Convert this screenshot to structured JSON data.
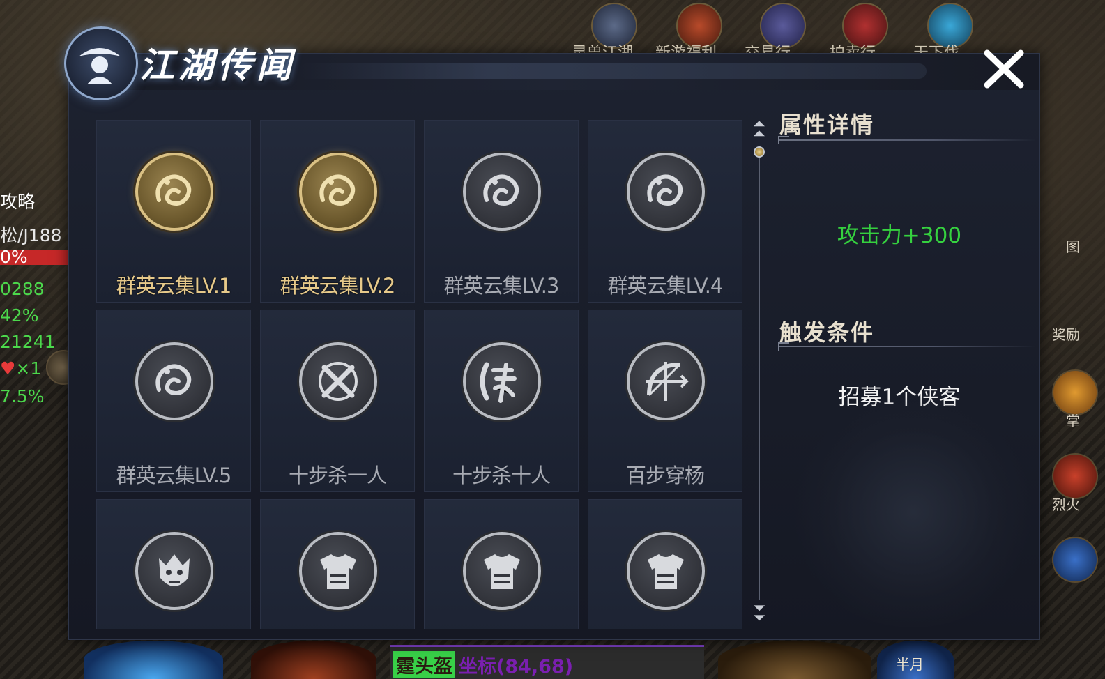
{
  "hud": {
    "strategy_label": "攻略",
    "player_name": "松/J188",
    "hp_percent": "0%",
    "stat_1": "0288",
    "stat_2": "42%",
    "stat_3": "21241",
    "stat_4": "×1",
    "stat_5": "7.5%"
  },
  "top_menu": [
    {
      "label": "灵兽江湖",
      "icon": "meditating-figure-icon"
    },
    {
      "label": "新游福利",
      "icon": "treasure-chest-icon"
    },
    {
      "label": "交易行",
      "icon": "trade-cart-icon"
    },
    {
      "label": "拍卖行",
      "icon": "auction-scroll-icon"
    },
    {
      "label": "天下伐",
      "icon": "swirl-orb-icon"
    }
  ],
  "right_hud": {
    "map_label": "图",
    "reward_label": "奖励",
    "palm_label": "掌",
    "fire_label": "烈火"
  },
  "bottom_bar": {
    "map_name": "霆头盔",
    "coordinates": "坐标(84,68)",
    "half_moon_label": "半月"
  },
  "panel": {
    "title": "江湖传闻",
    "close_icon": "close-x-icon",
    "logo_icon": "swordsman-hat-icon"
  },
  "achievements": [
    {
      "label": "群英云集LV.1",
      "state": "gold",
      "icon": "dragon-icon"
    },
    {
      "label": "群英云集LV.2",
      "state": "gold",
      "icon": "dragon-icon"
    },
    {
      "label": "群英云集LV.3",
      "state": "grey",
      "icon": "dragon-icon"
    },
    {
      "label": "群英云集LV.4",
      "state": "grey",
      "icon": "dragon-icon"
    },
    {
      "label": "群英云集LV.5",
      "state": "grey",
      "icon": "dragon-icon"
    },
    {
      "label": "十步杀一人",
      "state": "grey",
      "icon": "crossed-swords-icon"
    },
    {
      "label": "十步杀十人",
      "state": "grey",
      "icon": "slash-character-icon"
    },
    {
      "label": "百步穿杨",
      "state": "grey",
      "icon": "bow-arrow-icon"
    },
    {
      "label": "",
      "state": "grey",
      "icon": "demon-mask-icon"
    },
    {
      "label": "",
      "state": "grey",
      "icon": "armor-icon"
    },
    {
      "label": "",
      "state": "grey",
      "icon": "armor-icon"
    },
    {
      "label": "",
      "state": "grey",
      "icon": "armor-icon"
    }
  ],
  "detail": {
    "attribute_heading": "属性详情",
    "attribute_value": "攻击力+300",
    "condition_heading": "触发条件",
    "condition_value": "招募1个侠客"
  },
  "colors": {
    "gold_text": "#e6c98a",
    "grey_text": "#a8abb3",
    "attribute_green": "#35d13f",
    "panel_bg": "#1b2130"
  }
}
